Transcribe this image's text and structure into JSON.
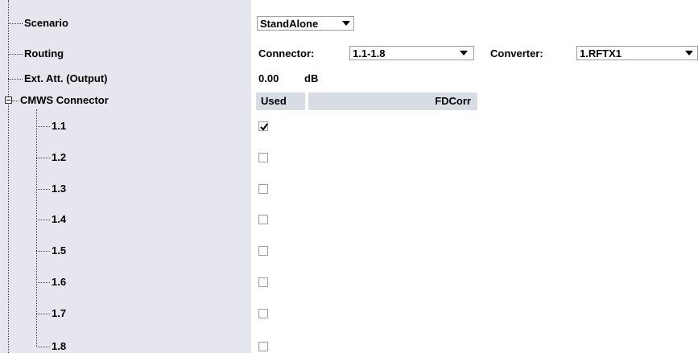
{
  "tree": {
    "items": [
      {
        "label": "Scenario"
      },
      {
        "label": "Routing"
      },
      {
        "label": "Ext. Att. (Output)"
      },
      {
        "label": "CMWS Connector"
      },
      {
        "label": "1.1"
      },
      {
        "label": "1.2"
      },
      {
        "label": "1.3"
      },
      {
        "label": "1.4"
      },
      {
        "label": "1.5"
      },
      {
        "label": "1.6"
      },
      {
        "label": "1.7"
      },
      {
        "label": "1.8"
      }
    ]
  },
  "scenario": {
    "value": "StandAlone"
  },
  "routing": {
    "connector_label": "Connector:",
    "connector_value": "1.1-1.8",
    "converter_label": "Converter:",
    "converter_value": "1.RFTX1"
  },
  "ext_att": {
    "value": "0.00",
    "unit": "dB"
  },
  "table": {
    "headers": {
      "used": "Used",
      "fdcorr": "FDCorr"
    },
    "rows": [
      {
        "connector": "1.1",
        "used": true
      },
      {
        "connector": "1.2",
        "used": false
      },
      {
        "connector": "1.3",
        "used": false
      },
      {
        "connector": "1.4",
        "used": false
      },
      {
        "connector": "1.5",
        "used": false
      },
      {
        "connector": "1.6",
        "used": false
      },
      {
        "connector": "1.7",
        "used": false
      },
      {
        "connector": "1.8",
        "used": false
      }
    ]
  }
}
